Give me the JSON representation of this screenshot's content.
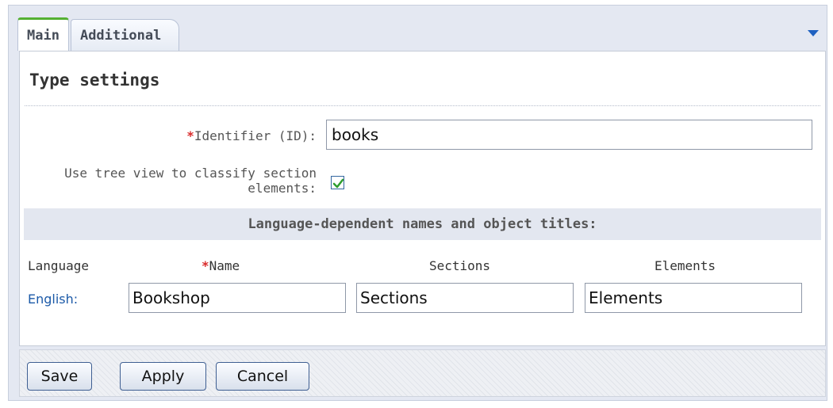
{
  "tabs": [
    {
      "label": "Main",
      "active": true
    },
    {
      "label": "Additional",
      "active": false
    }
  ],
  "heading": "Type settings",
  "identifier": {
    "required_mark": "*",
    "label": "Identifier (ID):",
    "value": "books"
  },
  "tree_view": {
    "label": "Use tree view to classify section elements:",
    "checked": true
  },
  "languages_section": {
    "title": "Language-dependent names and object titles:",
    "columns": {
      "language": "Language",
      "name_required": "*",
      "name": "Name",
      "sections": "Sections",
      "elements": "Elements"
    },
    "rows": [
      {
        "language": "English:",
        "name": "Bookshop",
        "sections": "Sections",
        "elements": "Elements"
      }
    ]
  },
  "buttons": {
    "save": "Save",
    "apply": "Apply",
    "cancel": "Cancel"
  },
  "colors": {
    "active_tab_accent": "#55b033",
    "required": "#d92b2b",
    "link": "#1c5aa8",
    "checkbox_check": "#2f9e2f"
  },
  "icons": {
    "collapse": "chevron-down-icon",
    "checkbox_mark": "check-icon"
  }
}
